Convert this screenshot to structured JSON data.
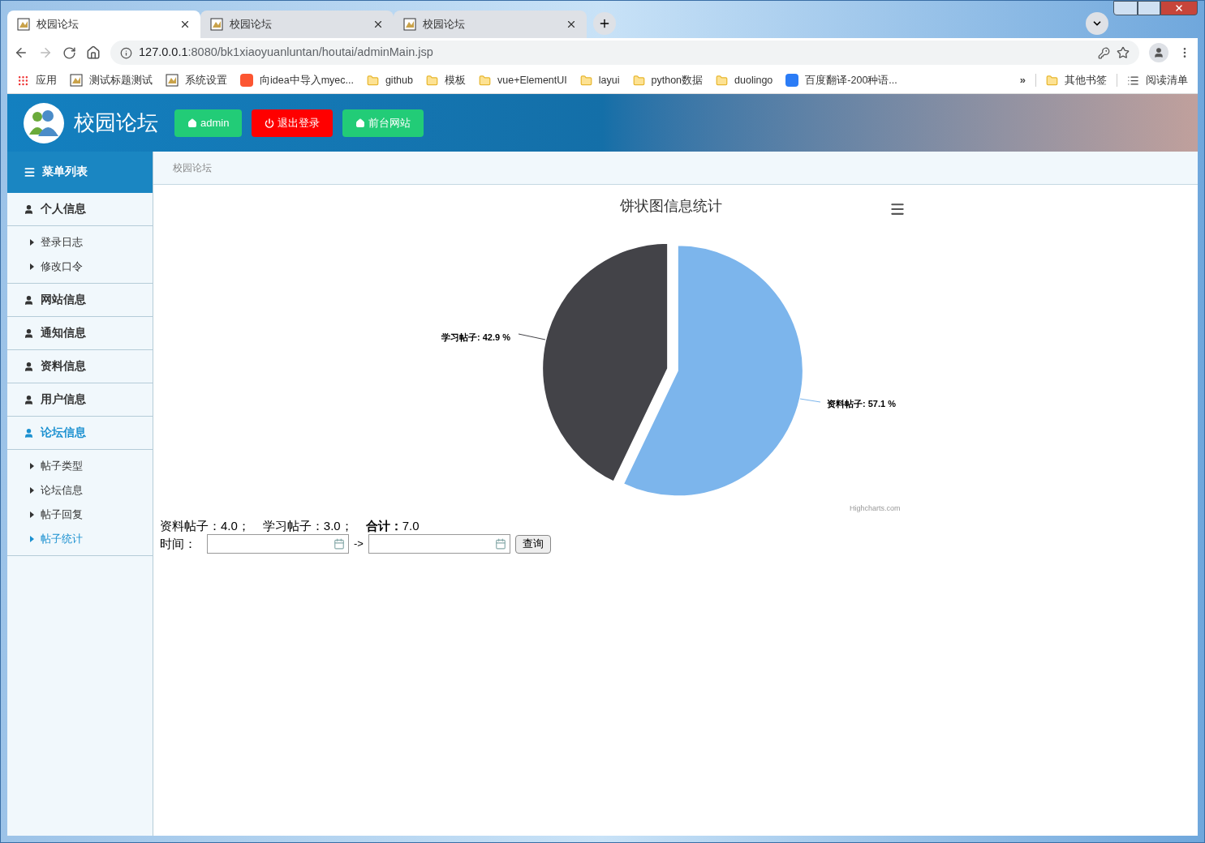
{
  "browser": {
    "tabs": [
      {
        "title": "校园论坛",
        "selected": true
      },
      {
        "title": "校园论坛",
        "selected": false
      },
      {
        "title": "校园论坛",
        "selected": false
      }
    ],
    "address": {
      "host": "127.0.0.1",
      "path": ":8080/bk1xiaoyuanluntan/houtai/adminMain.jsp"
    },
    "bookmarks": [
      {
        "label": "应用",
        "kind": "apps"
      },
      {
        "label": "测试标题测试",
        "kind": "page"
      },
      {
        "label": "系统设置",
        "kind": "page"
      },
      {
        "label": "向idea中导入myec...",
        "kind": "csdn"
      },
      {
        "label": "github",
        "kind": "folder"
      },
      {
        "label": "模板",
        "kind": "folder"
      },
      {
        "label": "vue+ElementUI",
        "kind": "folder"
      },
      {
        "label": "layui",
        "kind": "folder"
      },
      {
        "label": "python数据",
        "kind": "folder"
      },
      {
        "label": "duolingo",
        "kind": "folder"
      },
      {
        "label": "百度翻译-200种语...",
        "kind": "translate"
      }
    ],
    "more": "»",
    "other_bookmarks": [
      {
        "label": "其他书签",
        "kind": "folder"
      },
      {
        "label": "阅读清单",
        "kind": "list"
      }
    ]
  },
  "header": {
    "title": "校园论坛",
    "buttons": [
      {
        "label": "admin",
        "kind": "home",
        "color": "#22cc77"
      },
      {
        "label": "退出登录",
        "kind": "power",
        "color": "#ff0000"
      },
      {
        "label": "前台网站",
        "kind": "home",
        "color": "#22cc77"
      }
    ]
  },
  "sidebar": {
    "title": "菜单列表",
    "groups": [
      {
        "label": "个人信息",
        "selected": false,
        "children": [
          {
            "label": "登录日志",
            "selected": false
          },
          {
            "label": "修改口令",
            "selected": false
          }
        ]
      },
      {
        "label": "网站信息",
        "selected": false
      },
      {
        "label": "通知信息",
        "selected": false
      },
      {
        "label": "资料信息",
        "selected": false
      },
      {
        "label": "用户信息",
        "selected": false
      },
      {
        "label": "论坛信息",
        "selected": true,
        "children": [
          {
            "label": "帖子类型",
            "selected": false
          },
          {
            "label": "论坛信息",
            "selected": false
          },
          {
            "label": "帖子回复",
            "selected": false
          },
          {
            "label": "帖子统计",
            "selected": true
          }
        ]
      }
    ]
  },
  "breadcrumb": "校园论坛",
  "chart": {
    "chart_data": {
      "type": "pie",
      "title": "饼状图信息统计",
      "values": [
        57.1,
        42.9
      ],
      "colors": [
        "#7cb5ec",
        "#434348"
      ],
      "value_labels": [
        "资料帖子: 57.1 %",
        "学习帖子: 42.9 %"
      ]
    },
    "credit": "Highcharts.com"
  },
  "summary": [
    {
      "label": "资料帖子：",
      "value": "4.0；",
      "kind": "item"
    },
    {
      "label": "学习帖子：",
      "value": "3.0；",
      "kind": "item"
    },
    {
      "label": "合计：",
      "value": "7.0",
      "kind": "total"
    }
  ],
  "filter": {
    "label": "时间：",
    "separator": "->",
    "button": "查询"
  }
}
